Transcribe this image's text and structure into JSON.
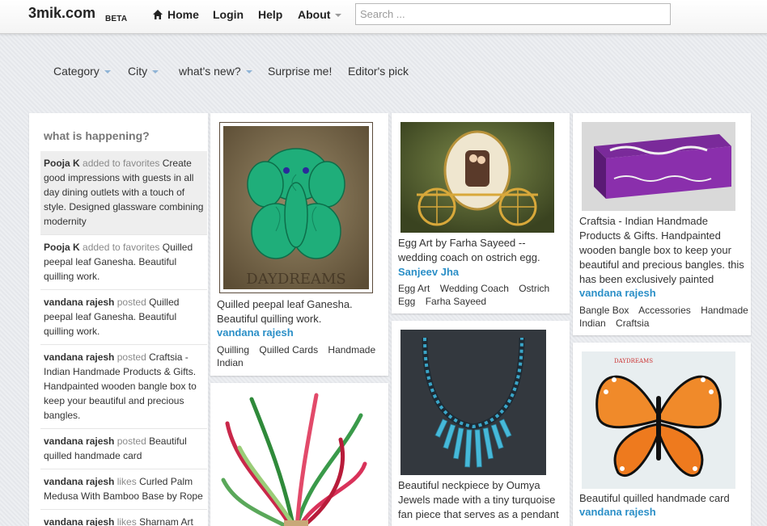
{
  "header": {
    "brand": "3mik.com",
    "beta": "BETA",
    "nav": {
      "home": "Home",
      "login": "Login",
      "help": "Help",
      "about": "About"
    },
    "search_placeholder": "Search ..."
  },
  "subnav": {
    "category": "Category",
    "city": "City",
    "whats_new": "what's new?",
    "surprise": "Surprise me!",
    "editors_pick": "Editor's pick"
  },
  "activity": {
    "title": "what is happening?",
    "items": [
      {
        "user": "Pooja K",
        "action": "added to favorites",
        "text": "Create good impressions with guests in all day dining outlets with a touch of style. Designed glassware combining modernity"
      },
      {
        "user": "Pooja K",
        "action": "added to favorites",
        "text": "Quilled peepal leaf Ganesha. Beautiful quilling work."
      },
      {
        "user": "vandana rajesh",
        "action": "posted",
        "text": "Quilled peepal leaf Ganesha. Beautiful quilling work."
      },
      {
        "user": "vandana rajesh",
        "action": "posted",
        "text": "Craftsia - Indian Handmade Products & Gifts. Handpainted wooden bangle box to keep your beautiful and precious bangles."
      },
      {
        "user": "vandana rajesh",
        "action": "posted",
        "text": "Beautiful quilled handmade card"
      },
      {
        "user": "vandana rajesh",
        "action": "likes",
        "text": "Curled Palm Medusa With Bamboo Base by Rope"
      },
      {
        "user": "vandana rajesh",
        "action": "likes",
        "text": "Sharnam Art"
      }
    ]
  },
  "cards": {
    "c1": {
      "image_caption": "DAYDREAMS",
      "desc": "Quilled peepal leaf Ganesha. Beautiful quilling work.",
      "author": "vandana rajesh",
      "tags": [
        "Quilling",
        "Quilled Cards",
        "Handmade",
        "Indian"
      ]
    },
    "c3": {
      "desc": "Egg Art by Farha Sayeed -- wedding coach on ostrich egg.",
      "author": "Sanjeev Jha",
      "tags": [
        "Egg Art",
        "Wedding Coach",
        "Ostrich",
        "Egg",
        "Farha Sayeed"
      ]
    },
    "c4": {
      "desc": "Beautiful neckpiece by Oumya Jewels made with a tiny turquoise fan piece that serves as a pendant"
    },
    "c5": {
      "desc": "Craftsia - Indian Handmade Products & Gifts. Handpainted wooden bangle box to keep your beautiful and precious bangles. this has been exclusively painted",
      "author": "vandana rajesh",
      "tags": [
        "Bangle Box",
        "Accessories",
        "Handmade Indian",
        "Craftsia"
      ]
    },
    "c6": {
      "image_caption": "DAYDREAMS",
      "desc": "Beautiful quilled handmade card",
      "author": "vandana rajesh"
    }
  },
  "colors": {
    "link_blue": "#2b8fc7",
    "caret_blue": "#8fb4d6",
    "background": "#e9ebef"
  },
  "icons": {
    "home": "home-icon",
    "about_caret": "chevron-down-icon"
  }
}
